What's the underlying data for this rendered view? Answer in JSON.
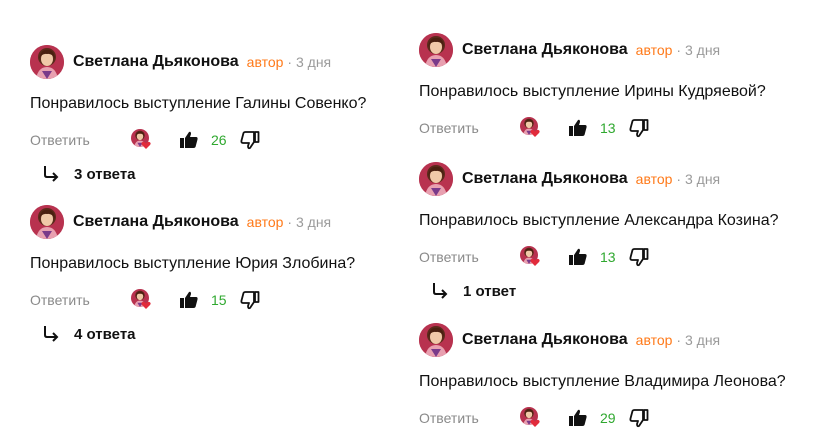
{
  "comments": [
    {
      "author": "Светлана Дьяконова",
      "badge": "автор",
      "time": "· 3 дня",
      "text": "Понравилось выступление Галины Совенко?",
      "reply_label": "Ответить",
      "likes": "26",
      "replies": "3 ответа"
    },
    {
      "author": "Светлана Дьяконова",
      "badge": "автор",
      "time": "· 3 дня",
      "text": "Понравилось выступление Юрия Злобина?",
      "reply_label": "Ответить",
      "likes": "15",
      "replies": "4 ответа"
    },
    {
      "author": "Светлана Дьяконова",
      "badge": "автор",
      "time": "· 3 дня",
      "text": "Понравилось выступление Ирины Кудряевой?",
      "reply_label": "Ответить",
      "likes": "13",
      "replies": ""
    },
    {
      "author": "Светлана Дьяконова",
      "badge": "автор",
      "time": "· 3 дня",
      "text": "Понравилось выступление Александра Козина?",
      "reply_label": "Ответить",
      "likes": "13",
      "replies": "1 ответ"
    },
    {
      "author": "Светлана Дьяконова",
      "badge": "автор",
      "time": "· 3 дня",
      "text": "Понравилось выступление Владимира Леонова?",
      "reply_label": "Ответить",
      "likes": "29",
      "replies": ""
    }
  ],
  "colors": {
    "badge": "#ff7a1a",
    "likes": "#2fa82f",
    "muted": "#8a8a8a"
  },
  "icons": {
    "like": "thumbs-up-icon",
    "dislike": "thumbs-down-icon",
    "replies": "reply-arrow-icon",
    "reaction": "author-heart-reaction-icon"
  }
}
